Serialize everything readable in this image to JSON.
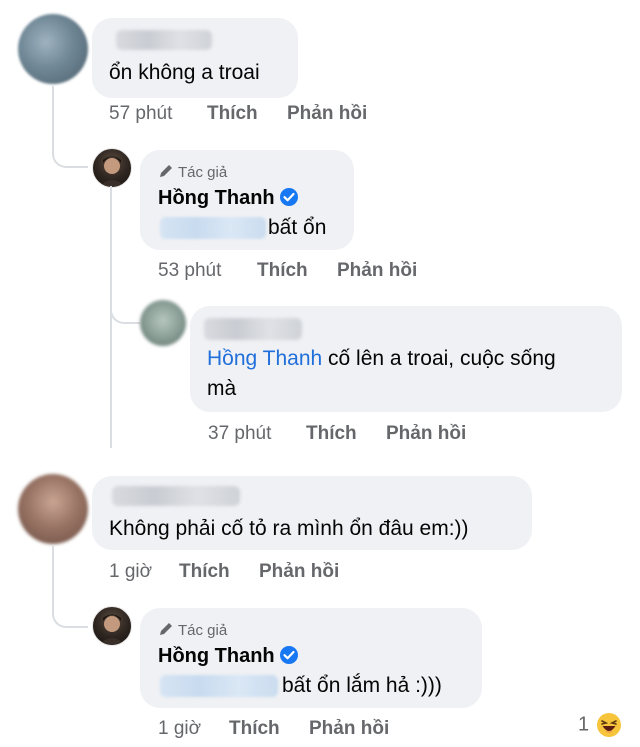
{
  "comments": [
    {
      "text": "ổn không a troai",
      "time": "57 phút",
      "like": "Thích",
      "reply": "Phản hồi"
    },
    {
      "author_tag": "Tác giả",
      "author_name": "Hồng Thanh",
      "text": "bất ổn",
      "time": "53 phút",
      "like": "Thích",
      "reply": "Phản hồi"
    },
    {
      "mention": "Hồng Thanh",
      "text_line1": "cố lên a troai, cuộc sống",
      "text_line2": "mà",
      "time": "37 phút",
      "like": "Thích",
      "reply": "Phản hồi"
    },
    {
      "text": "Không phải cố tỏ ra mình ổn đâu em:))",
      "time": "1 giờ",
      "like": "Thích",
      "reply": "Phản hồi"
    },
    {
      "author_tag": "Tác giả",
      "author_name": "Hồng Thanh",
      "text": "bất ổn lắm hả :)))",
      "time": "1 giờ",
      "like": "Thích",
      "reply": "Phản hồi",
      "reaction_count": "1",
      "reaction_icon": "laughing-emoji-icon"
    }
  ],
  "colors": {
    "bubble": "#eff1f4",
    "mention": "#216fdb",
    "meta": "#65676b",
    "verified": "#1877f2"
  }
}
